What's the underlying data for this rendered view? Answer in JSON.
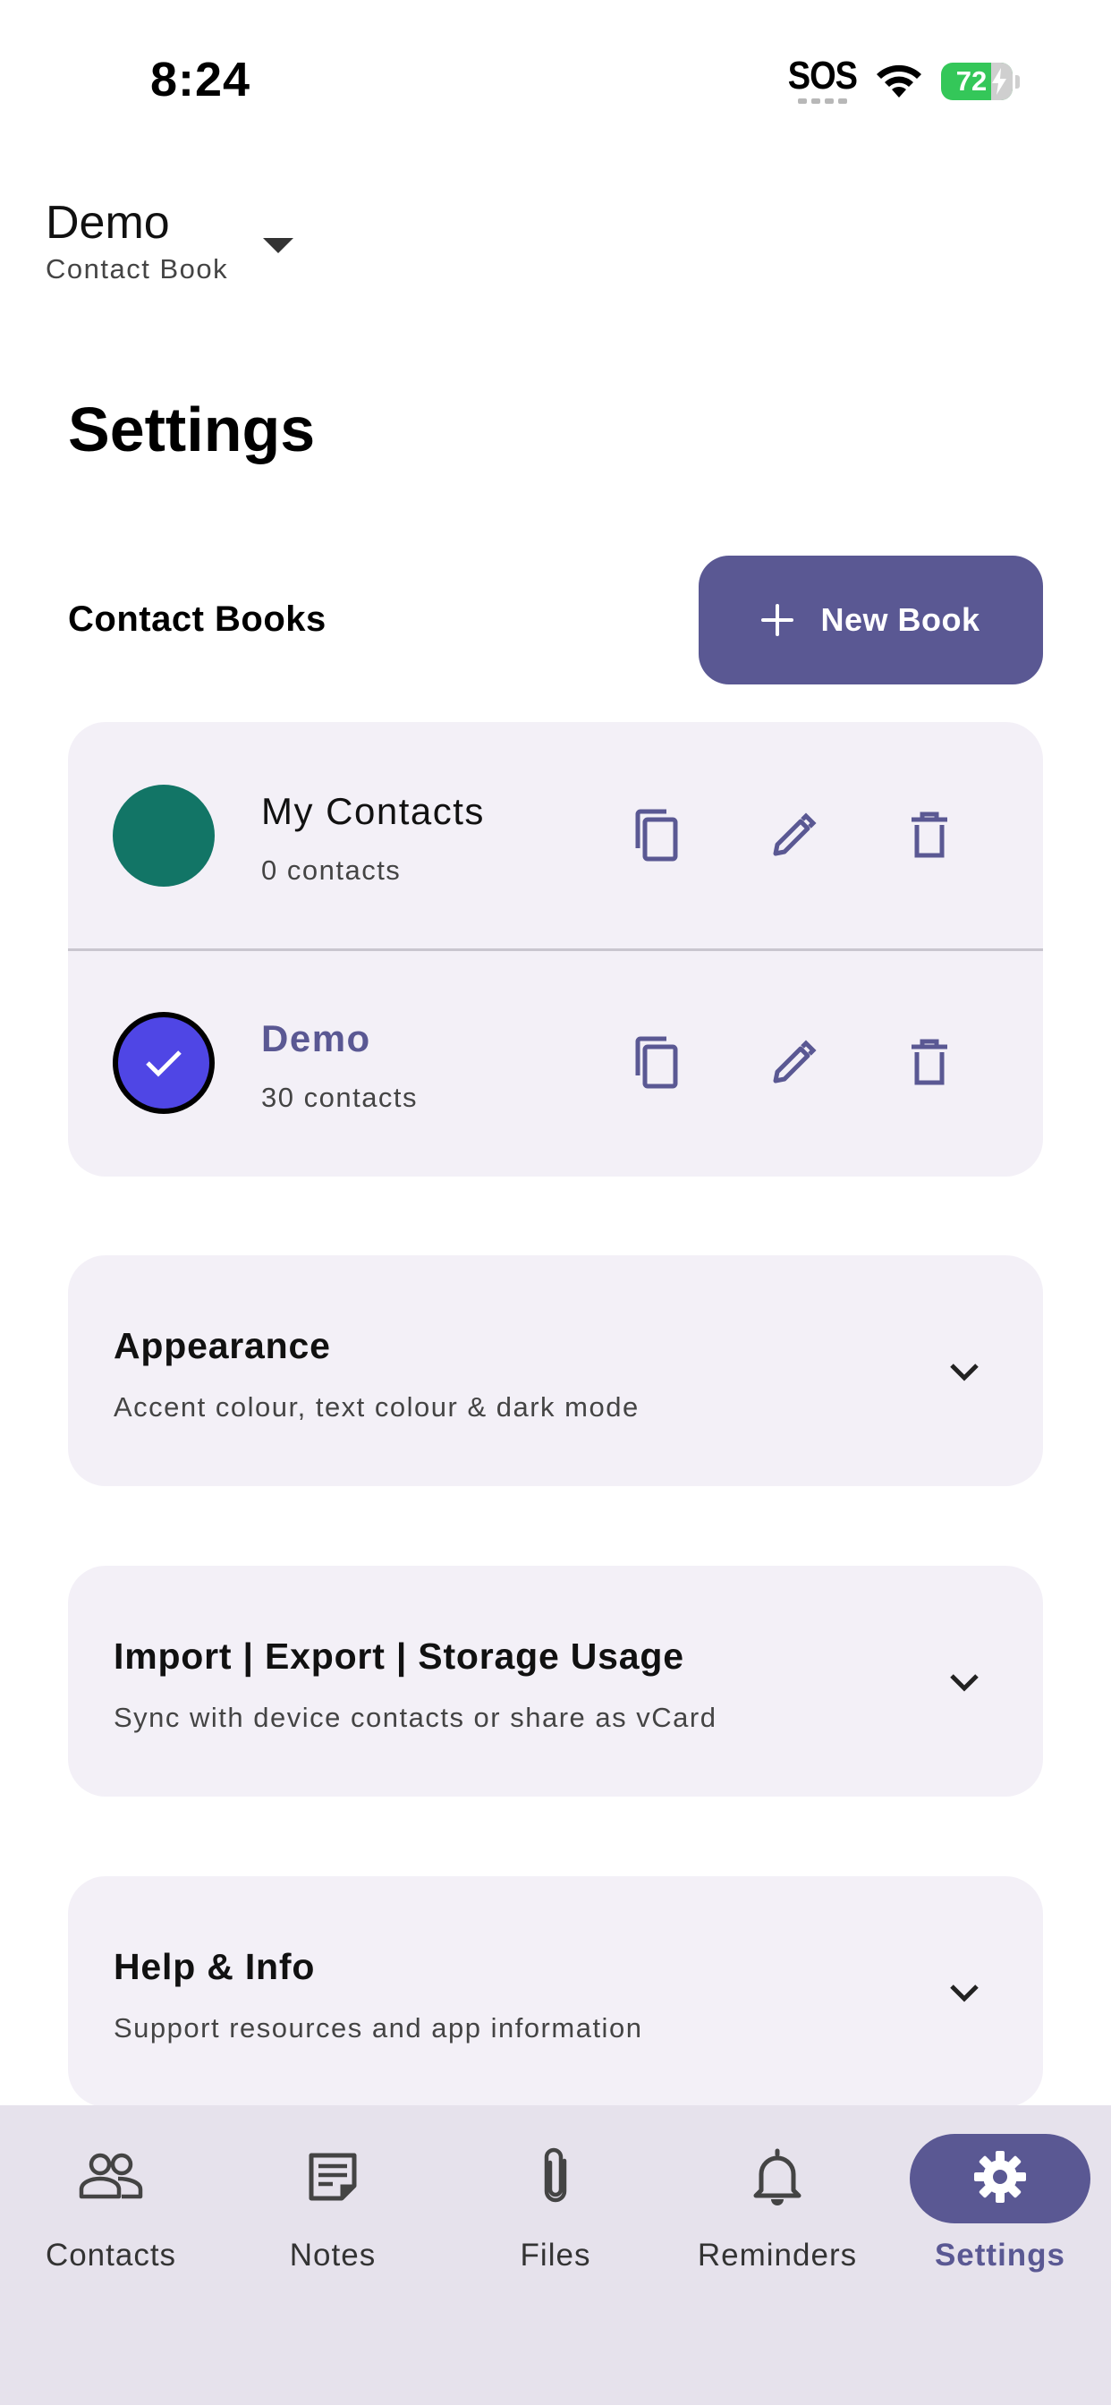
{
  "status_bar": {
    "time": "8:24",
    "sos": "SOS",
    "battery": "72"
  },
  "book_selector": {
    "name": "Demo",
    "subtitle": "Contact Book"
  },
  "page_title": "Settings",
  "contact_books": {
    "label": "Contact Books",
    "new_book_label": "New Book",
    "books": [
      {
        "name": "My Contacts",
        "count": "0 contacts",
        "color": "#127566",
        "selected": false
      },
      {
        "name": "Demo",
        "count": "30 contacts",
        "color": "#4f46e5",
        "selected": true
      }
    ]
  },
  "sections": [
    {
      "title": "Appearance",
      "subtitle": "Accent colour, text colour & dark mode"
    },
    {
      "title": "Import | Export | Storage Usage",
      "subtitle": "Sync with device contacts or share as vCard"
    },
    {
      "title": "Help & Info",
      "subtitle": "Support resources and app information"
    }
  ],
  "bottom_nav": {
    "items": [
      {
        "label": "Contacts",
        "icon": "people-icon"
      },
      {
        "label": "Notes",
        "icon": "note-icon"
      },
      {
        "label": "Files",
        "icon": "paperclip-icon"
      },
      {
        "label": "Reminders",
        "icon": "bell-icon"
      },
      {
        "label": "Settings",
        "icon": "gear-icon"
      }
    ],
    "active": "Settings"
  },
  "colors": {
    "accent": "#5a5893",
    "card_bg": "#f3f0f7",
    "nav_bg": "#e6e2ec",
    "battery": "#34c759"
  }
}
